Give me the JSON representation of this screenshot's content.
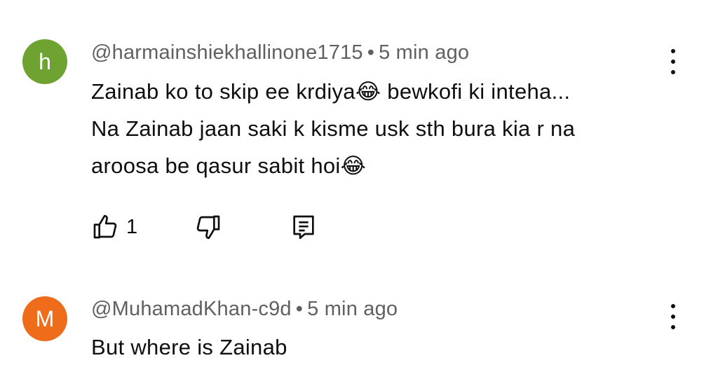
{
  "comments": [
    {
      "avatar_letter": "h",
      "avatar_color": "#6ea231",
      "author": "@harmainshiekhallinone1715",
      "separator": "•",
      "time": "5 min ago",
      "lines": [
        "Zainab ko to skip ee krdiya😂 bewkofi ki inteha...",
        "Na Zainab jaan saki k kisme usk sth bura kia r na",
        "aroosa be qasur sabit hoi😂"
      ],
      "like_count": "1",
      "icons": [
        "thumbs-up-icon",
        "thumbs-down-icon",
        "reply-icon",
        "more-vert-icon"
      ]
    },
    {
      "avatar_letter": "M",
      "avatar_color": "#ef6c1a",
      "author": "@MuhamadKhan-c9d",
      "separator": "•",
      "time": "5 min ago",
      "lines": [
        "But where is Zainab"
      ],
      "icons": [
        "more-vert-icon"
      ]
    }
  ]
}
